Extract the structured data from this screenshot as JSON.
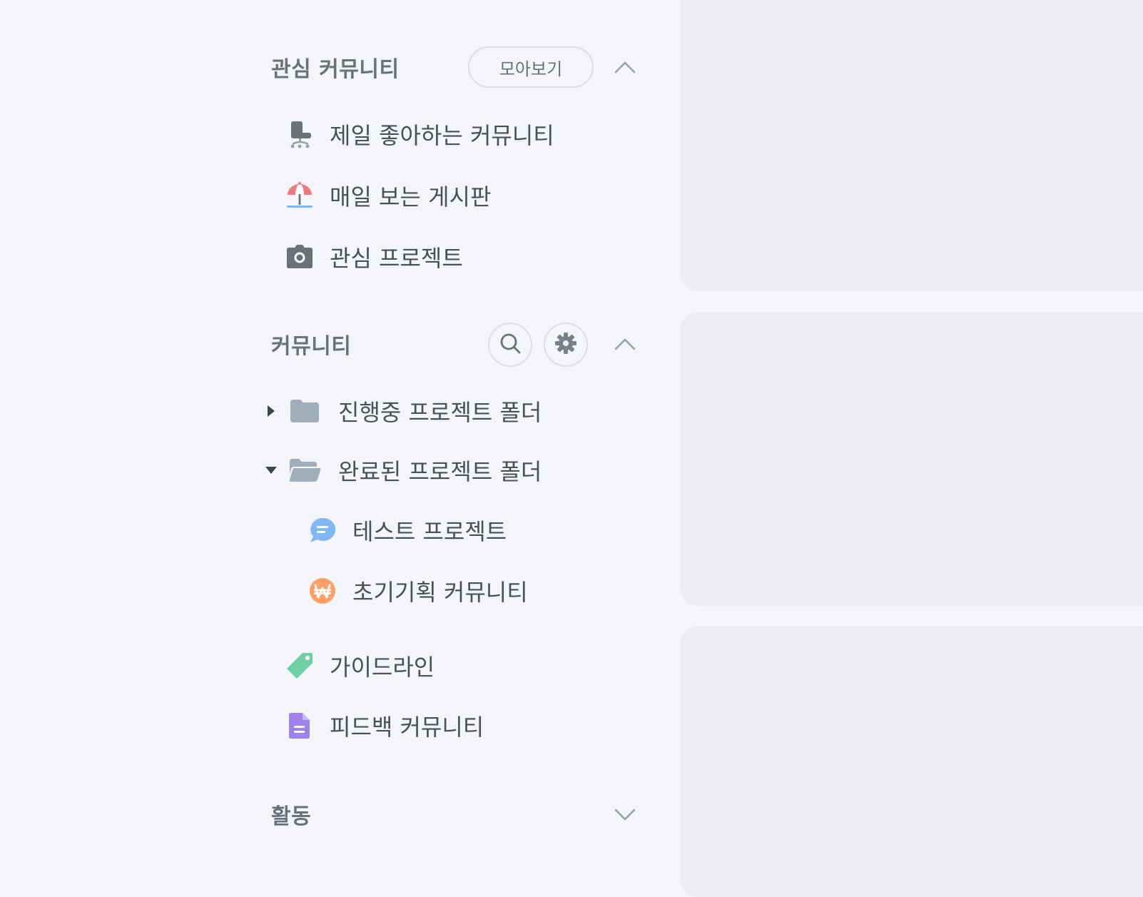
{
  "favorites": {
    "title": "관심 커뮤니티",
    "view_all_label": "모아보기",
    "items": [
      {
        "label": "제일 좋아하는 커뮤니티",
        "icon": "office-chair-icon"
      },
      {
        "label": "매일 보는 게시판",
        "icon": "beach-umbrella-icon"
      },
      {
        "label": "관심 프로젝트",
        "icon": "camera-icon"
      }
    ]
  },
  "community": {
    "title": "커뮤니티",
    "folders": [
      {
        "label": "진행중 프로젝트 폴더",
        "state": "collapsed",
        "icon": "folder-closed-icon"
      },
      {
        "label": "완료된 프로젝트 폴더",
        "state": "expanded",
        "icon": "folder-open-icon",
        "children": [
          {
            "label": "테스트 프로젝트",
            "icon": "chat-bubble-icon"
          },
          {
            "label": "초기기획 커뮤니티",
            "icon": "won-coin-icon"
          }
        ]
      }
    ],
    "items": [
      {
        "label": "가이드라인",
        "icon": "tag-icon"
      },
      {
        "label": "피드백 커뮤니티",
        "icon": "document-icon"
      }
    ]
  },
  "activity": {
    "title": "활동"
  },
  "colors": {
    "sidebar_bg": "#f4f5f9",
    "panel_bg": "#ededf2",
    "text": "#4b5058",
    "muted": "#6b7079"
  }
}
